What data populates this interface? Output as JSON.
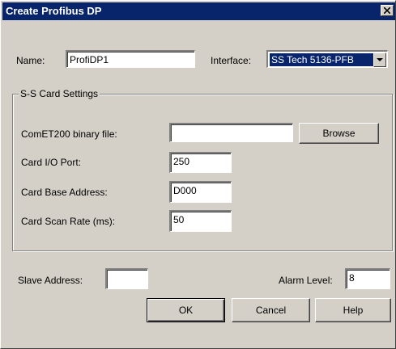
{
  "window": {
    "title": "Create Profibus DP",
    "close_icon": "close-icon"
  },
  "name": {
    "label": "Name:",
    "value": "ProfiDP1"
  },
  "interface": {
    "label": "Interface:",
    "value": "SS Tech 5136-PFB",
    "arrow_icon": "chevron-down-icon"
  },
  "group": {
    "title": "S-S Card Settings",
    "binary_file": {
      "label": "ComET200 binary file:",
      "value": ""
    },
    "browse_label": "Browse",
    "io_port": {
      "label": "Card I/O Port:",
      "value": "250"
    },
    "base_address": {
      "label": "Card Base Address:",
      "value": "D000"
    },
    "scan_rate": {
      "label": "Card Scan Rate (ms):",
      "value": "50"
    }
  },
  "slave_address": {
    "label": "Slave Address:",
    "value": ""
  },
  "alarm_level": {
    "label": "Alarm Level:",
    "value": "8"
  },
  "buttons": {
    "ok": "OK",
    "cancel": "Cancel",
    "help": "Help"
  },
  "colors": {
    "titlebar": "#08246b",
    "face": "#d4d0c8",
    "selection": "#08246b"
  }
}
